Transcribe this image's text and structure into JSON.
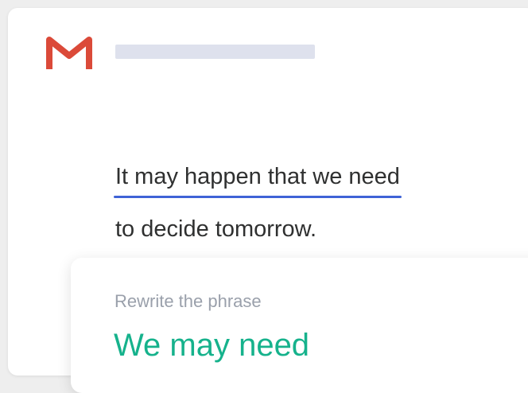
{
  "header": {
    "logo_icon": "gmail-icon"
  },
  "email": {
    "highlighted_phrase": "It may happen that we need",
    "rest_text": "to decide tomorrow."
  },
  "suggestion": {
    "label": "Rewrite the phrase",
    "text": "We may need"
  },
  "colors": {
    "gmail_red": "#db4a39",
    "placeholder_gray": "#dee1ed",
    "underline_blue": "#3f63d6",
    "suggestion_green": "#16b28c"
  }
}
